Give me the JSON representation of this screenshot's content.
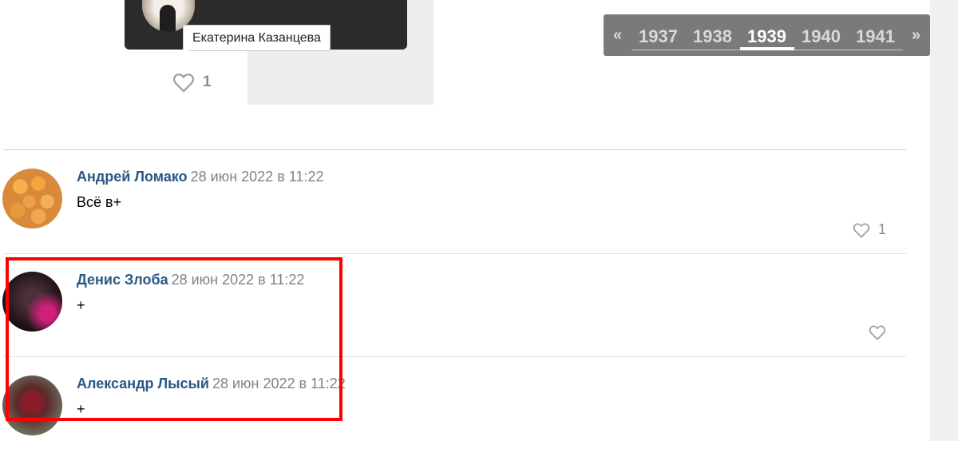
{
  "photo_popup": {
    "tooltip_name": "Екатерина Казанцева",
    "like_count": "1"
  },
  "pager": {
    "prev_label": "«",
    "next_label": "»",
    "pages": [
      "1937",
      "1938",
      "1939",
      "1940",
      "1941"
    ],
    "active_page": "1939"
  },
  "comments": [
    {
      "author": "Андрей Ломако",
      "date": "28 июн 2022 в 11:22",
      "text": "Всё в+",
      "likes": "1"
    },
    {
      "author": "Денис Злоба",
      "date": "28 июн 2022 в 11:22",
      "text": "+",
      "likes": ""
    },
    {
      "author": "Александр Лысый",
      "date": "28 июн 2022 в 11:22",
      "text": "+",
      "likes": ""
    }
  ],
  "colors": {
    "author": "#2a5885",
    "date": "#828282",
    "highlight": "#ff0000",
    "pager_bg": "#7a7a7a"
  }
}
